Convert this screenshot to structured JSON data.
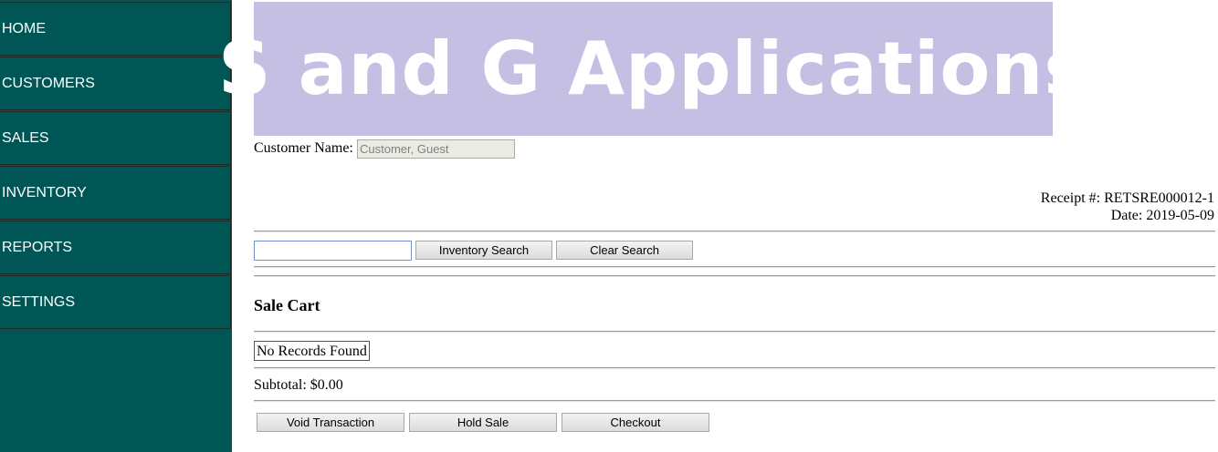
{
  "sidebar": {
    "items": [
      {
        "label": "HOME"
      },
      {
        "label": "CUSTOMERS"
      },
      {
        "label": "SALES"
      },
      {
        "label": "INVENTORY"
      },
      {
        "label": "REPORTS"
      },
      {
        "label": "SETTINGS"
      }
    ]
  },
  "banner": {
    "title": "S and G Applications"
  },
  "customer": {
    "label": "Customer Name:",
    "value": "Customer, Guest"
  },
  "receipt": {
    "number_label": "Receipt #: RETSRE000012-1",
    "date_label": "Date: 2019-05-09"
  },
  "search": {
    "value": "",
    "inventory_search_label": "Inventory Search",
    "clear_search_label": "Clear Search"
  },
  "cart": {
    "heading": "Sale Cart",
    "empty_message": "No Records Found",
    "subtotal": "Subtotal: $0.00"
  },
  "actions": {
    "void_label": "Void Transaction",
    "hold_label": "Hold Sale",
    "checkout_label": "Checkout"
  },
  "colors": {
    "sidebar_bg": "#005555",
    "banner_bg": "#c6bfe4"
  }
}
